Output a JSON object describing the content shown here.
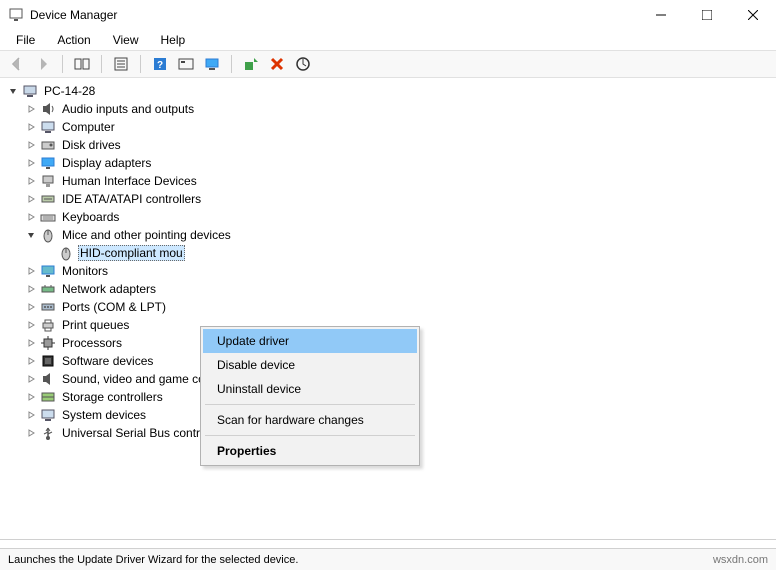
{
  "window": {
    "title": "Device Manager"
  },
  "menubar": {
    "items": [
      "File",
      "Action",
      "View",
      "Help"
    ]
  },
  "toolbar": {
    "buttons": [
      {
        "name": "back-icon",
        "disabled": true
      },
      {
        "name": "forward-icon",
        "disabled": true
      },
      {
        "name": "show-hide-console-icon"
      },
      {
        "name": "properties-toolbar-icon"
      },
      {
        "name": "help-icon"
      },
      {
        "name": "show-hidden-icon"
      },
      {
        "name": "monitor-icon"
      },
      {
        "name": "update-driver-toolbar-icon"
      },
      {
        "name": "uninstall-toolbar-icon"
      },
      {
        "name": "scan-hardware-icon"
      }
    ]
  },
  "tree": {
    "root": {
      "label": "PC-14-28",
      "expanded": true
    },
    "categories": [
      {
        "icon": "audio",
        "label": "Audio inputs and outputs"
      },
      {
        "icon": "computer",
        "label": "Computer"
      },
      {
        "icon": "disk",
        "label": "Disk drives"
      },
      {
        "icon": "display",
        "label": "Display adapters"
      },
      {
        "icon": "hid",
        "label": "Human Interface Devices"
      },
      {
        "icon": "ide",
        "label": "IDE ATA/ATAPI controllers"
      },
      {
        "icon": "keyboard",
        "label": "Keyboards"
      },
      {
        "icon": "mouse",
        "label": "Mice and other pointing devices",
        "expanded": true,
        "children": [
          {
            "icon": "mouse",
            "label": "HID-compliant mouse",
            "selected": true,
            "truncated": "HID-compliant mou"
          }
        ]
      },
      {
        "icon": "monitor",
        "label": "Monitors"
      },
      {
        "icon": "network",
        "label": "Network adapters"
      },
      {
        "icon": "port",
        "label": "Ports (COM & LPT)"
      },
      {
        "icon": "printq",
        "label": "Print queues"
      },
      {
        "icon": "cpu",
        "label": "Processors"
      },
      {
        "icon": "soft",
        "label": "Software devices"
      },
      {
        "icon": "sound",
        "label": "Sound, video and game controllers"
      },
      {
        "icon": "storage",
        "label": "Storage controllers"
      },
      {
        "icon": "system",
        "label": "System devices"
      },
      {
        "icon": "usb",
        "label": "Universal Serial Bus controllers"
      }
    ]
  },
  "context_menu": {
    "items": [
      {
        "label": "Update driver",
        "highlighted": true
      },
      {
        "label": "Disable device"
      },
      {
        "label": "Uninstall device"
      },
      {
        "sep": true
      },
      {
        "label": "Scan for hardware changes"
      },
      {
        "sep": true
      },
      {
        "label": "Properties",
        "bold": true
      }
    ]
  },
  "statusbar": {
    "left": "Launches the Update Driver Wizard for the selected device.",
    "right": "wsxdn.com"
  }
}
